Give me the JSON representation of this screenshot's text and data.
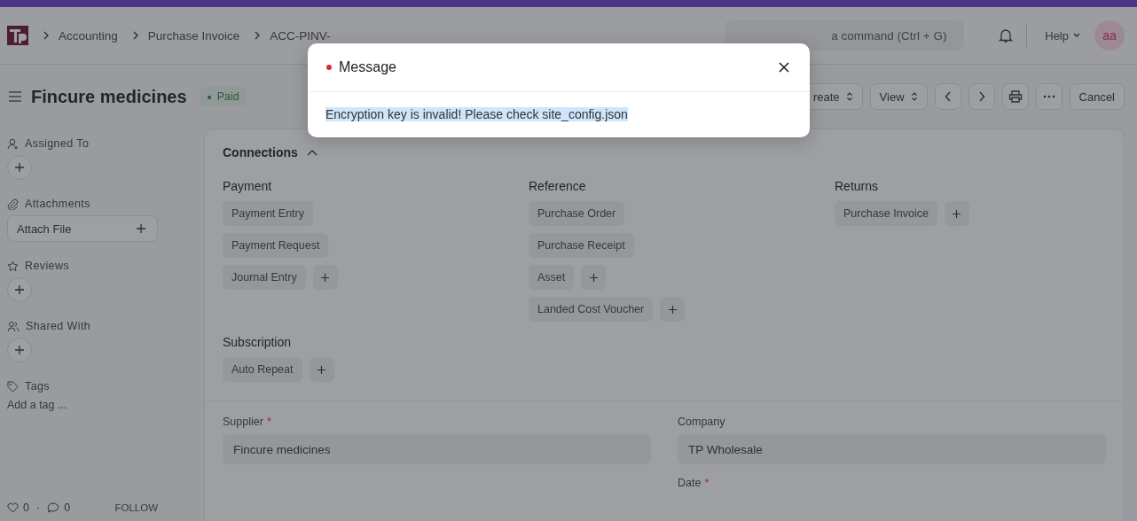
{
  "navbar": {
    "breadcrumbs": [
      "Accounting",
      "Purchase Invoice",
      "ACC-PINV-"
    ],
    "search": {
      "placeholder": "a command (Ctrl + G)"
    },
    "help": "Help",
    "avatar": "aa"
  },
  "page": {
    "title": "Fincure medicines",
    "status": "Paid",
    "actions": [
      {
        "kind": "dropdown",
        "label": "reate"
      },
      {
        "kind": "dropdown",
        "label": "View"
      },
      {
        "kind": "prev"
      },
      {
        "kind": "next"
      },
      {
        "kind": "print"
      },
      {
        "kind": "more"
      },
      {
        "kind": "text",
        "label": "Cancel"
      }
    ]
  },
  "sidebar": {
    "sections": [
      {
        "kind": "add",
        "title": "Assigned To"
      },
      {
        "kind": "attach",
        "title": "Attachments",
        "button": "Attach File"
      },
      {
        "kind": "add",
        "title": "Reviews"
      },
      {
        "kind": "add",
        "title": "Shared With"
      },
      {
        "kind": "tags",
        "title": "Tags",
        "placeholder": "Add a tag ..."
      }
    ],
    "likes": "0",
    "separator": "·",
    "comments": "0",
    "follow": "FOLLOW"
  },
  "connections": {
    "title": "Connections",
    "expanded": true,
    "groups": [
      {
        "title": "Payment",
        "links": [
          {
            "label": "Payment Entry",
            "add": false
          },
          {
            "label": "Payment Request",
            "add": false
          },
          {
            "label": "Journal Entry",
            "add": true
          }
        ]
      },
      {
        "title": "Reference",
        "links": [
          {
            "label": "Purchase Order",
            "add": false
          },
          {
            "label": "Purchase Receipt",
            "add": false
          },
          {
            "label": "Asset",
            "add": true
          },
          {
            "label": "Landed Cost Voucher",
            "add": true
          }
        ]
      },
      {
        "title": "Returns",
        "links": [
          {
            "label": "Purchase Invoice",
            "add": true
          }
        ]
      },
      {
        "title": "Subscription",
        "links": [
          {
            "label": "Auto Repeat",
            "add": true
          }
        ]
      }
    ]
  },
  "form": {
    "required_mark": "*",
    "left_fields": [
      {
        "label": "Supplier",
        "required": true,
        "value": "Fincure medicines"
      }
    ],
    "right_fields": [
      {
        "label": "Company",
        "required": false,
        "value": "TP Wholesale"
      },
      {
        "label": "Date",
        "required": true
      }
    ]
  },
  "dialog": {
    "title": "Message",
    "color": "#d0312d",
    "message": "Encryption key is invalid! Please check site_config.json",
    "selected": true
  }
}
